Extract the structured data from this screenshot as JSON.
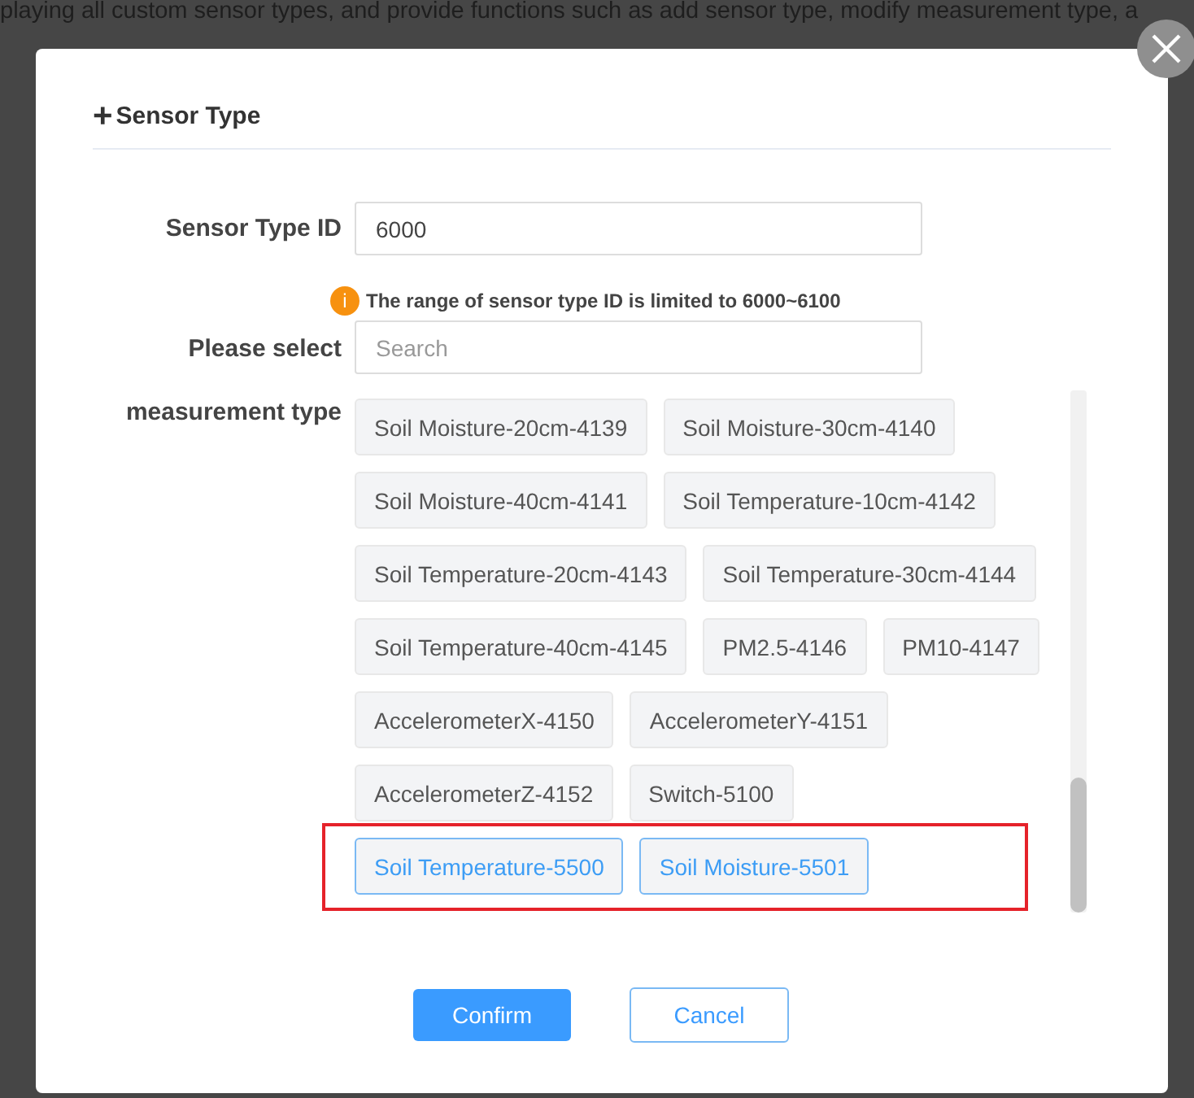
{
  "background_text": "playing all custom sensor types, and provide functions such as add sensor type, modify measurement type, a",
  "dialog": {
    "title_icon": "+",
    "title": "Sensor Type",
    "id_field": {
      "label": "Sensor Type ID",
      "value": "6000"
    },
    "hint": {
      "icon": "i",
      "text": "The range of sensor type ID is limited to 6000~6100"
    },
    "search_field": {
      "label_lines": [
        "Please select",
        "measurement type"
      ],
      "placeholder": "Search"
    },
    "tag_rows": [
      {
        "highlighted": false,
        "tags": [
          {
            "label": "Soil Moisture-20cm-4139",
            "selected": false
          },
          {
            "label": "Soil Moisture-30cm-4140",
            "selected": false
          }
        ]
      },
      {
        "highlighted": false,
        "tags": [
          {
            "label": "Soil Moisture-40cm-4141",
            "selected": false
          },
          {
            "label": "Soil Temperature-10cm-4142",
            "selected": false
          }
        ]
      },
      {
        "highlighted": false,
        "tags": [
          {
            "label": "Soil Temperature-20cm-4143",
            "selected": false
          },
          {
            "label": "Soil Temperature-30cm-4144",
            "selected": false
          }
        ]
      },
      {
        "highlighted": false,
        "tags": [
          {
            "label": "Soil Temperature-40cm-4145",
            "selected": false
          },
          {
            "label": "PM2.5-4146",
            "selected": false
          },
          {
            "label": "PM10-4147",
            "selected": false
          }
        ]
      },
      {
        "highlighted": false,
        "tags": [
          {
            "label": "AccelerometerX-4150",
            "selected": false
          },
          {
            "label": "AccelerometerY-4151",
            "selected": false
          }
        ]
      },
      {
        "highlighted": false,
        "tags": [
          {
            "label": "AccelerometerZ-4152",
            "selected": false
          },
          {
            "label": "Switch-5100",
            "selected": false
          }
        ]
      },
      {
        "highlighted": true,
        "tags": [
          {
            "label": "Soil Temperature-5500",
            "selected": true
          },
          {
            "label": "Soil Moisture-5501",
            "selected": true
          }
        ]
      }
    ],
    "buttons": [
      {
        "label": "Confirm",
        "kind": "primary"
      },
      {
        "label": "Cancel",
        "kind": "secondary"
      }
    ]
  }
}
